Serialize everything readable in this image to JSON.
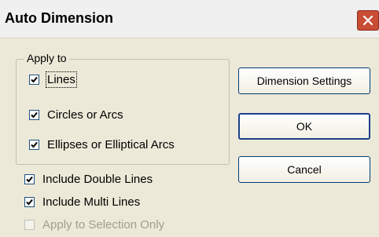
{
  "dialog": {
    "title": "Auto Dimension",
    "group_label": "Apply to",
    "apply_to": [
      {
        "label": "Lines",
        "checked": true
      },
      {
        "label": "Circles or Arcs",
        "checked": true
      },
      {
        "label": "Ellipses or Elliptical Arcs",
        "checked": true
      }
    ],
    "include_double_lines": {
      "label": "Include Double Lines",
      "checked": true
    },
    "include_multi_lines": {
      "label": "Include Multi Lines",
      "checked": true
    },
    "apply_to_selection_only": {
      "label": "Apply to Selection Only",
      "checked": false,
      "disabled": true
    },
    "buttons": {
      "dimension_settings": "Dimension Settings",
      "ok": "OK",
      "cancel": "Cancel"
    }
  },
  "colors": {
    "dialog_bg": "#ECE9D8",
    "close_button": "#C94C35",
    "check_border": "#1C5180"
  }
}
